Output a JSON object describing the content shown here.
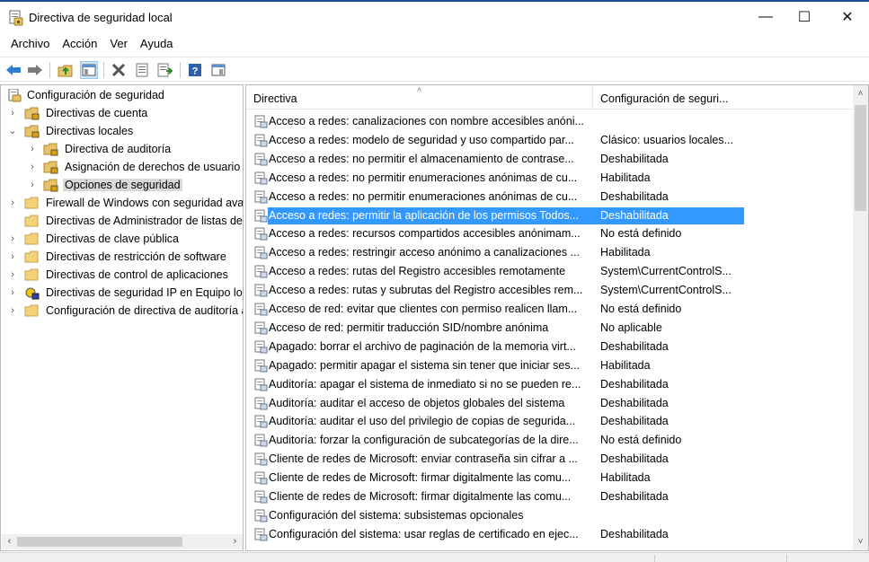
{
  "window": {
    "title": "Directiva de seguridad local",
    "minimize_glyph": "—",
    "maximize_glyph": "☐",
    "close_glyph": "✕"
  },
  "menu": [
    "Archivo",
    "Acción",
    "Ver",
    "Ayuda"
  ],
  "toolbar_icons": [
    "back-icon",
    "forward-icon",
    "up-folder-icon",
    "show-hide-tree-icon",
    "delete-icon",
    "properties-icon",
    "export-list-icon",
    "help-icon",
    "view-icon"
  ],
  "tree": [
    {
      "label": "Configuración de seguridad",
      "expander": "",
      "icon": "security-settings-icon"
    },
    {
      "label": "Directivas de cuenta",
      "expander": "›",
      "icon": "folder-lock-icon"
    },
    {
      "label": "Directivas locales",
      "expander": "⌄",
      "icon": "folder-lock-icon"
    },
    {
      "label": "Directiva de auditoría",
      "expander": "›",
      "icon": "folder-lock-icon"
    },
    {
      "label": "Asignación de derechos de usuario",
      "expander": "›",
      "icon": "folder-lock-icon"
    },
    {
      "label": "Opciones de seguridad",
      "expander": "›",
      "icon": "folder-lock-icon",
      "selected": true
    },
    {
      "label": "Firewall de Windows con seguridad avanzada",
      "expander": "›",
      "icon": "folder-icon"
    },
    {
      "label": "Directivas de Administrador de listas de redes",
      "expander": "",
      "icon": "folder-icon"
    },
    {
      "label": "Directivas de clave pública",
      "expander": "›",
      "icon": "folder-icon"
    },
    {
      "label": "Directivas de restricción de software",
      "expander": "›",
      "icon": "folder-icon"
    },
    {
      "label": "Directivas de control de aplicaciones",
      "expander": "›",
      "icon": "folder-icon"
    },
    {
      "label": "Directivas de seguridad IP en Equipo local",
      "expander": "›",
      "icon": "ip-security-icon"
    },
    {
      "label": "Configuración de directiva de auditoría avanzada",
      "expander": "›",
      "icon": "folder-icon"
    }
  ],
  "scroll_glyphs": {
    "left": "‹",
    "right": "›",
    "up": "˄",
    "down": "˅"
  },
  "columns": {
    "col1": "Directiva",
    "col2": "Configuración de seguri..."
  },
  "sort_caret": "˄",
  "rows": [
    {
      "name": "Acceso a redes: canalizaciones con nombre accesibles anóni...",
      "value": ""
    },
    {
      "name": "Acceso a redes: modelo de seguridad y uso compartido par...",
      "value": "Clásico: usuarios locales..."
    },
    {
      "name": "Acceso a redes: no permitir el almacenamiento de contrase...",
      "value": "Deshabilitada"
    },
    {
      "name": "Acceso a redes: no permitir enumeraciones anónimas de cu...",
      "value": "Habilitada"
    },
    {
      "name": "Acceso a redes: no permitir enumeraciones anónimas de cu...",
      "value": "Deshabilitada"
    },
    {
      "name": "Acceso a redes: permitir la aplicación de los permisos Todos...",
      "value": "Deshabilitada",
      "selected": true
    },
    {
      "name": "Acceso a redes: recursos compartidos accesibles anónimam...",
      "value": "No está definido"
    },
    {
      "name": "Acceso a redes: restringir acceso anónimo a canalizaciones ...",
      "value": "Habilitada"
    },
    {
      "name": "Acceso a redes: rutas del Registro accesibles remotamente",
      "value": "System\\CurrentControlS..."
    },
    {
      "name": "Acceso a redes: rutas y subrutas del Registro accesibles rem...",
      "value": "System\\CurrentControlS..."
    },
    {
      "name": "Acceso de red: evitar que clientes con permiso realicen llam...",
      "value": "No está definido"
    },
    {
      "name": "Acceso de red: permitir traducción SID/nombre anónima",
      "value": "No aplicable"
    },
    {
      "name": "Apagado: borrar el archivo de paginación de la memoria virt...",
      "value": "Deshabilitada"
    },
    {
      "name": "Apagado: permitir apagar el sistema sin tener que iniciar ses...",
      "value": "Habilitada"
    },
    {
      "name": "Auditoría: apagar el sistema de inmediato si no se pueden re...",
      "value": "Deshabilitada"
    },
    {
      "name": "Auditoría: auditar el acceso de objetos globales del sistema",
      "value": "Deshabilitada"
    },
    {
      "name": "Auditoría: auditar el uso del privilegio de copias de segurida...",
      "value": "Deshabilitada"
    },
    {
      "name": "Auditoría: forzar la configuración de subcategorías de la dire...",
      "value": "No está definido"
    },
    {
      "name": "Cliente de redes de Microsoft: enviar contraseña sin cifrar a ...",
      "value": "Deshabilitada"
    },
    {
      "name": "Cliente de redes de Microsoft: firmar digitalmente las comu...",
      "value": "Habilitada"
    },
    {
      "name": "Cliente de redes de Microsoft: firmar digitalmente las comu...",
      "value": "Deshabilitada"
    },
    {
      "name": "Configuración del sistema: subsistemas opcionales",
      "value": ""
    },
    {
      "name": "Configuración del sistema: usar reglas de certificado en ejec...",
      "value": "Deshabilitada"
    }
  ],
  "colors": {
    "selection": "#3399ff",
    "tree_selection": "#d9d9d9",
    "folder": "#e8c36a"
  }
}
